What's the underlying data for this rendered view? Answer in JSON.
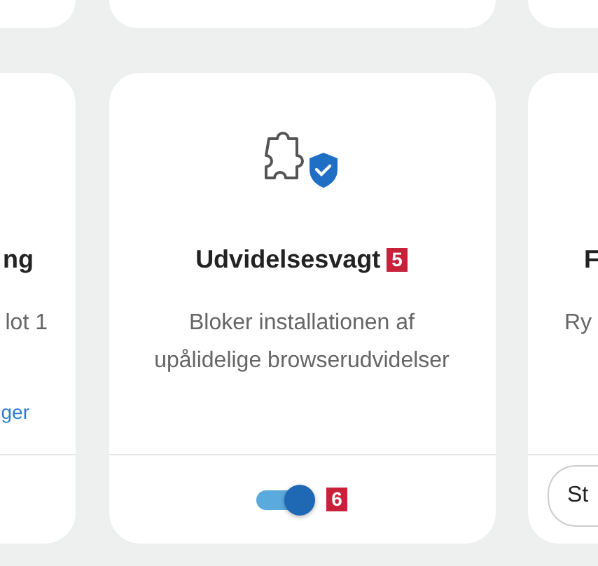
{
  "cards": [
    {
      "title": "ng",
      "description": "lot 1",
      "link": "ger"
    },
    {
      "title": "Udvidelsesvagt",
      "callout": "5",
      "description": "Bloker installationen af upålidelige browserudvidelser",
      "toggle": {
        "on": true,
        "callout": "6"
      }
    },
    {
      "title": "F",
      "description": "Ry",
      "button": "St"
    }
  ]
}
